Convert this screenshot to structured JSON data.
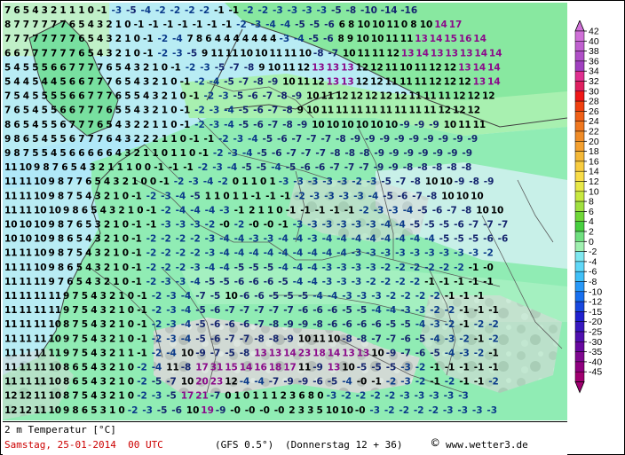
{
  "title": "2 m Temperatur [°C]",
  "date_line": "Samstag, 25-01-2014  00 UTC",
  "model": "(GFS 0.5°)",
  "forecast": "(Donnerstag 12 + 36)",
  "copyright_symbol": "©",
  "source": "www.wetter3.de",
  "legend": {
    "labels": [
      "42",
      "40",
      "38",
      "36",
      "34",
      "32",
      "30",
      "28",
      "26",
      "24",
      "22",
      "20",
      "18",
      "16",
      "14",
      "12",
      "10",
      "8",
      "6",
      "4",
      "2",
      "0",
      "-2",
      "-4",
      "-6",
      "-8",
      "-10",
      "-12",
      "-15",
      "-20",
      "-25",
      "-30",
      "-35",
      "-40",
      "-45"
    ],
    "colors": [
      "#d070d8",
      "#c060d0",
      "#b050c8",
      "#a040c0",
      "#e03090",
      "#e02060",
      "#f01818",
      "#f04010",
      "#f06018",
      "#f07820",
      "#f08c28",
      "#f4a030",
      "#f4b838",
      "#f8cc40",
      "#f8dc48",
      "#e8e848",
      "#c8e840",
      "#a0e040",
      "#70d838",
      "#48d040",
      "#70e080",
      "#a0f0b0",
      "#80e8f0",
      "#60d8f8",
      "#40c0f8",
      "#2898f8",
      "#1870f0",
      "#1848e0",
      "#2020d0",
      "#3818c0",
      "#5010b0",
      "#6808a0",
      "#800890",
      "#900080",
      "#a00070"
    ]
  },
  "grid_rows": [
    "7 6 5 4 3 2 1 1 1 0 -1 -3 -5 -4 -2 -2 -2 -2 -1 -1 -2 -2 -3 -3 -3 -3 -5 -8 -10 -14 -16",
    "8 7 7 7 7 7 7 6 5 4 3 2 1 0 -1 -1 -1 -1 -1 -1 -1 -2 -3 -4 -4 -5 -5 -6 6 8 10 10 11 0 8 10 14 17",
    "7 7 7 7 7 7 7 7 6 5 4 3 2 1 0 -1 -2 -4 7 8 6 4 4 4 4 4 4 4 -3 -4 -5 -6 8 9 10 10 11 11 13 14 15 16 14",
    "6 6 7 7 7 7 7 7 6 5 4 3 2 1 0 -1 -2 -3 -5 9 11 11 10 10 11 11 10 -8 -7 10 11 11 12 13 14 13 13 13 14 14",
    "5 4 5 5 5 6 6 7 7 7 7 6 5 4 3 2 1 0 -1 -2 -3 -5 -7 -8 9 10 11 12 13 13 13 12 12 11 10 11 12 12 13 14 14",
    "5 4 4 5 4 4 5 6 6 7 7 7 6 5 4 3 2 1 0 -1 -2 -4 -5 -7 -8 -9 10 11 12 13 13 12 12 11 11 11 12 12 12 13 14",
    "7 5 4 5 5 5 5 6 6 7 7 7 6 5 5 4 3 2 1 0 -1 -2 -3 -5 -6 -7 -8 -9 10 11 12 12 12 12 12 11 11 11 12 12 12",
    "7 6 5 4 5 5 6 6 7 7 7 6 5 5 4 3 2 1 0 -1 -2 -3 -4 -5 -6 -7 -8 9 10 11 11 11 11 11 11 11 11 12 12 12",
    "8 6 5 4 5 5 6 7 7 7 6 5 4 3 2 2 1 1 0 -1 -2 -3 -4 -5 -6 -7 -8 -9 10 10 10 10 10 10 -9 -9 -9 10 11 11",
    "9 8 6 5 4 5 5 6 7 7 7 6 4 3 2 2 2 1 1 0 -1 -1 -2 -3 -4 -5 -6 -7 -7 -7 -8 -9 -9 -9 -9 -9 -9 -9 -9 -9",
    "9 8 7 5 5 4 5 6 6 6 6 6 4 3 2 1 1 0 1 1 0 -1 -2 -3 -4 -5 -6 -7 -7 -7 -8 -8 -8 -9 -9 -9 -9 -9 -9 -9",
    "11 10 9 8 7 6 5 4 3 2 1 1 1 0 0 -1 -1 -1 -2 -3 -4 -5 -5 -4 -5 -6 -6 -7 -7 -7 -9 -9 -8 -8 -8 -8 -8",
    "11 11 10 9 8 7 7 6 5 4 3 2 1 0 0 -1 -2 -3 -4 -2 0 1 1 0 1 -3 -3 -3 -3 -3 -2 -3 -5 -7 -8 10 10 -9 -8 -9",
    "11 11 10 9 8 7 5 4 3 2 1 0 -1 -2 -3 -4 -5 1 1 0 1 1 -1 -1 -1 -2 -3 -3 -3 -3 -4 -5 -6 -7 -8 10 10 10",
    "11 11 10 10 9 8 6 5 4 3 2 1 0 -1 -2 -4 -4 -4 -3 -1 2 1 1 0 -1 -1 -1 -1 -1 -2 -3 -3 -4 -5 -6 -7 -8 10 10",
    "10 10 10 9 8 7 6 5 3 2 1 0 -1 -1 -3 -3 -3 -2 -0 -2 -0 -0 -1 -3 -3 -3 -3 -3 -3 -4 -4 -5 -5 -5 -6 -7 -7 -7",
    "10 10 10 9 8 6 5 4 3 2 1 0 -1 -2 -2 -2 -2 -3 -4 -4 -3 -3 -4 -4 -3 -4 -4 -4 -4 -4 -4 -4 -4 -5 -5 -5 -6 -6",
    "11 11 10 9 8 7 5 4 3 2 1 0 -1 -2 -2 -2 -2 -3 -4 -4 -4 -4 -4 -4 -4 -4 -4 -3 -3 -3 -3 -3 -3 -3 -3 -3 -2",
    "11 11 10 9 8 6 5 4 3 2 1 0 -1 -2 -2 -2 -3 -4 -4 -5 -5 -5 -4 -4 -4 -3 -3 -3 -3 -2 -2 -2 -2 -2 -2 -1 -0",
    "11 11 11 9 7 6 5 4 3 2 1 0 -1 -2 -3 -3 -4 -5 -5 -6 -6 -6 -5 -4 -4 -3 -3 -3 -2 -2 -2 -2 -1 -1 -1 -1 -1",
    "11 11 11 11 9 7 5 4 3 2 1 0 -1 -2 -3 -4 -7 -5 10 -6 -6 -5 -5 -5 -4 -4 -3 -3 -3 -2 -2 -2 -2 -1 -1 -1",
    "11 11 11 11 9 7 5 4 3 2 1 0 -1 -2 -3 -4 -5 -6 -7 -7 -7 -7 -7 -6 -6 -6 -5 -5 -4 -4 -3 -3 -2 -2 -1 -1 -1",
    "11 11 11 10 8 7 5 4 3 2 1 0 -1 -2 -3 -4 -5 -6 -6 -6 -7 -8 -9 -9 -8 -6 -6 -6 -6 -5 -5 -4 -3 -2 -1 -2 -2",
    "11 11 11 10 9 7 5 4 3 2 1 0 -1 -2 -3 -4 -5 -6 -7 -7 -8 -8 -9 10 11 10 -8 -8 -7 -7 -6 -5 -4 -3 -2 -1 -2",
    "11 11 11 11 9 7 5 4 3 2 1 1 -1 -2 -4 10 -9 -7 -5 -8 13 13 14 23 18 14 13 13 10 -9 -7 -6 -5 -4 -3 -2 -1",
    "11 11 11 10 8 6 5 4 3 2 1 0 -2 -4 11 -8 17 31 15 14 16 18 17 11 -9 13 10 -5 -5 -5 -3 -2 -1 -1 -1 -1 -1",
    "11 11 11 10 8 6 5 4 3 2 1 0 -2 -5 -7 10 20 23 12 -4 -4 -7 -9 -9 -6 -5 -4 -0 -1 -2 -3 -2 -1 -2 -1 -1 -2",
    "12 12 11 10 8 7 5 4 3 2 1 0 -2 -3 -5 17 21 -7 0 1 0 1 1 1 2 3 6 8 0 -3 -2 -2 -2 -2 -3 -3 -3 -3 -3",
    "12 12 11 10 9 8 6 5 3 1 0 -2 -3 -5 -6 10 19 -9 -0 -0 -0 -0 2 3 3 5 10 10 -0 -3 -2 -2 -2 -2 -3 -3 -3 -3"
  ]
}
